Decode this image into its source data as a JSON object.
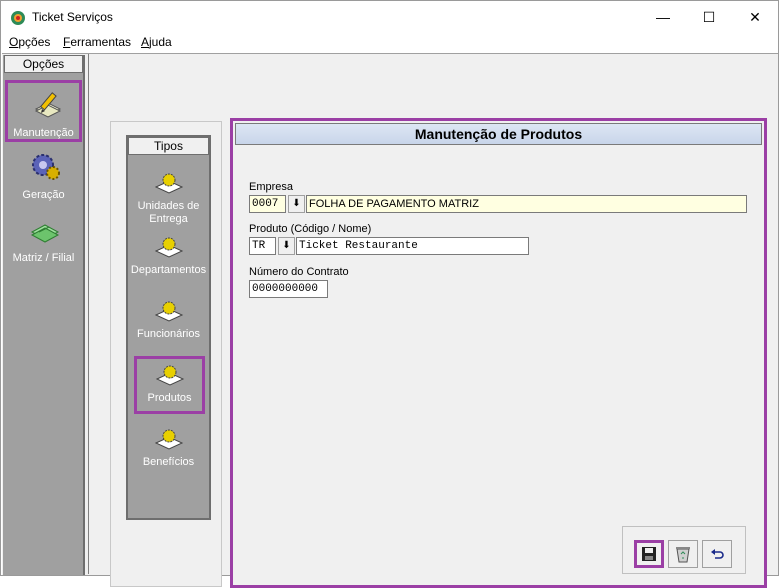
{
  "window": {
    "title": "Ticket Serviços",
    "controls": {
      "minimize": "—",
      "maximize": "☐",
      "close": "✕"
    }
  },
  "menu": [
    {
      "underline": "O",
      "rest": "pções"
    },
    {
      "underline": "F",
      "rest": "erramentas"
    },
    {
      "underline": "A",
      "rest": "juda"
    }
  ],
  "left_panel": {
    "header": "Opções",
    "items": [
      {
        "label": "Manutenção",
        "icon": "pencil-paper-icon",
        "active": true
      },
      {
        "label": "Geração",
        "icon": "gear-icon"
      },
      {
        "label": "Matriz / Filial",
        "icon": "green-pages-icon"
      }
    ]
  },
  "tipos": {
    "header": "Tipos",
    "items": [
      {
        "label": "Unidades de Entrega"
      },
      {
        "label": "Departamentos"
      },
      {
        "label": "Funcionários"
      },
      {
        "label": "Produtos",
        "active": true
      },
      {
        "label": "Benefícios"
      }
    ]
  },
  "form": {
    "title": "Manutenção de Produtos",
    "empresa": {
      "label": "Empresa",
      "code": "0007",
      "name": "FOLHA DE PAGAMENTO MATRIZ"
    },
    "produto": {
      "label": "Produto (Código / Nome)",
      "code": "TR",
      "name": "Ticket Restaurante"
    },
    "contrato": {
      "label": "Número do Contrato",
      "value": "0000000000"
    },
    "buttons": [
      {
        "icon": "save-icon",
        "active": true
      },
      {
        "icon": "recycle-bin-icon"
      },
      {
        "icon": "undo-icon"
      }
    ]
  },
  "colors": {
    "highlight": "#9b3fa5",
    "panel": "#a0a0a0"
  }
}
